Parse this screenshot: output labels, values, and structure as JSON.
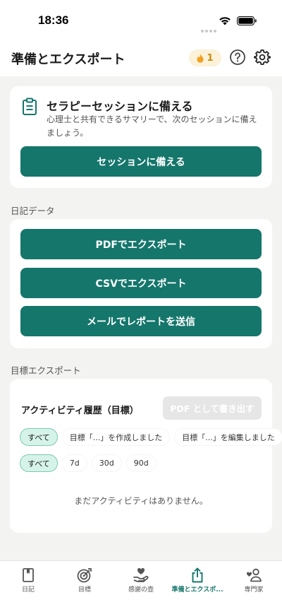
{
  "status_bar": {
    "time": "18:36"
  },
  "header": {
    "title": "準備とエクスポート",
    "streak_count": "1"
  },
  "session_card": {
    "title": "セラピーセッションに備える",
    "description": "心理士と共有できるサマリーで、次のセッションに備えましょう。",
    "button_label": "セッションに備える"
  },
  "diary_section": {
    "label": "日記データ",
    "buttons": [
      {
        "label": "PDFでエクスポート"
      },
      {
        "label": "CSVでエクスポート"
      },
      {
        "label": "メールでレポートを送信"
      }
    ]
  },
  "goals_section": {
    "label": "目標エクスポート",
    "activity_title": "アクティビティ履歴（目標）",
    "pdf_button": "PDF として書き出す",
    "type_filters": [
      "すべて",
      "目標「...」を作成しました",
      "目標「...」を編集しました"
    ],
    "range_filters": [
      "すべて",
      "7d",
      "30d",
      "90d"
    ],
    "empty_message": "まだアクティビティはありません。"
  },
  "tab_bar": {
    "items": [
      {
        "label": "日記",
        "icon": "book-icon"
      },
      {
        "label": "目標",
        "icon": "target-icon"
      },
      {
        "label": "感謝の壺",
        "icon": "heart-hand-icon"
      },
      {
        "label": "準備とエクスポ...",
        "icon": "share-icon"
      },
      {
        "label": "専門家",
        "icon": "people-icon"
      }
    ],
    "active_index": 3
  },
  "colors": {
    "accent": "#15766b",
    "chip_active_bg": "#d6f3ea",
    "streak_bg": "#fcf1d9",
    "disabled_button": "#e6e6e6"
  }
}
